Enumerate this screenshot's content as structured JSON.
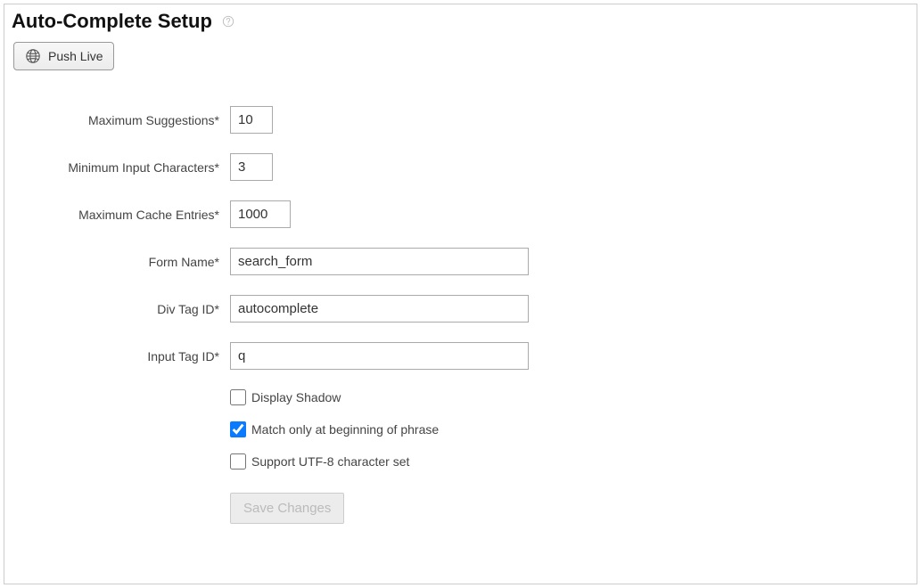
{
  "header": {
    "title": "Auto-Complete Setup",
    "push_live_label": "Push Live"
  },
  "form": {
    "max_suggestions": {
      "label": "Maximum Suggestions*",
      "value": "10"
    },
    "min_input_chars": {
      "label": "Minimum Input Characters*",
      "value": "3"
    },
    "max_cache_entries": {
      "label": "Maximum Cache Entries*",
      "value": "1000"
    },
    "form_name": {
      "label": "Form Name*",
      "value": "search_form"
    },
    "div_tag_id": {
      "label": "Div Tag ID*",
      "value": "autocomplete"
    },
    "input_tag_id": {
      "label": "Input Tag ID*",
      "value": "q"
    },
    "display_shadow": {
      "label": "Display Shadow",
      "checked": false
    },
    "match_beginning": {
      "label": "Match only at beginning of phrase",
      "checked": true
    },
    "support_utf8": {
      "label": "Support UTF-8 character set",
      "checked": false
    },
    "save_button_label": "Save Changes"
  }
}
